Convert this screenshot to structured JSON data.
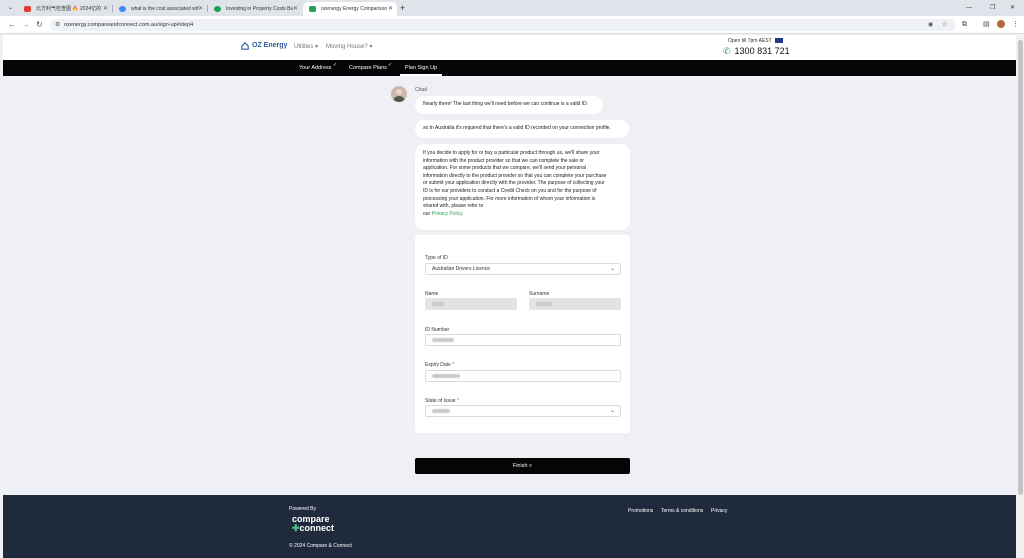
{
  "browser": {
    "tabs": [
      {
        "title": "北方利气检查图 🔥 2024亿的",
        "active": false
      },
      {
        "title": "what is the cost associated wit",
        "active": false
      },
      {
        "title": "Investing in Property Costs Bu",
        "active": false
      },
      {
        "title": "ozenergy Energy Comparison",
        "active": true
      }
    ],
    "new_tab": "+",
    "url": "ozenergy.compareandconnect.com.au/sign-up#step4"
  },
  "header": {
    "logo": "OZ Energy",
    "menu": [
      {
        "label": "Utilities ▾"
      },
      {
        "label": "Moving House? ▾"
      }
    ],
    "open_till": "Open till 7pm AEST",
    "phone": "1300 831 721"
  },
  "steps": [
    {
      "label": "Your Address",
      "done": true
    },
    {
      "label": "Compare Plans",
      "done": true
    },
    {
      "label": "Plan Sign Up",
      "done": false
    }
  ],
  "chat": {
    "agent": "Chad",
    "messages": [
      "Nearly there! The last thing we'll need before we can continue is a valid ID.",
      "so In Australia it's required that there's a valid ID recorded on your connection profile."
    ],
    "privacy_lines": [
      "If you decide to apply for or buy a particular product through us, we'll share your",
      "information with the product provider so that we can complete the sale or",
      "application. For some products that we compare, we'll send your personal",
      "information directly to the product provider so that you can complete your purchase",
      "or submit your application directly with the provider. The purpose of collecting your",
      "ID is for our providers to conduct a Credit Check on you and for the purpose of",
      "processing your application. For more information of whom your information is",
      "shared with, please refer to"
    ],
    "privacy_prefix": "our",
    "privacy_link": "Privacy Policy"
  },
  "form": {
    "type_label": "Type of ID",
    "type_value": "Australian Drivers Licence",
    "name_label": "Name",
    "surname_label": "Surname",
    "id_number_label": "ID Number",
    "expiry_label": "Expiry Date",
    "state_label": "State of Issue",
    "required_mark": "*"
  },
  "finish_label": "Finish",
  "footer": {
    "powered_by": "Powered By",
    "brand_line1": "compare",
    "brand_line2": "connect",
    "copyright": "© 2024 Compare & Connect",
    "links": [
      "Promotions",
      "Terms & conditions",
      "Privacy"
    ]
  },
  "colors": {
    "accent_green": "#2a9d57",
    "footer_bg": "#1f2b3d",
    "stepbar_bg": "#050505",
    "logo_blue": "#2a5b9c"
  }
}
